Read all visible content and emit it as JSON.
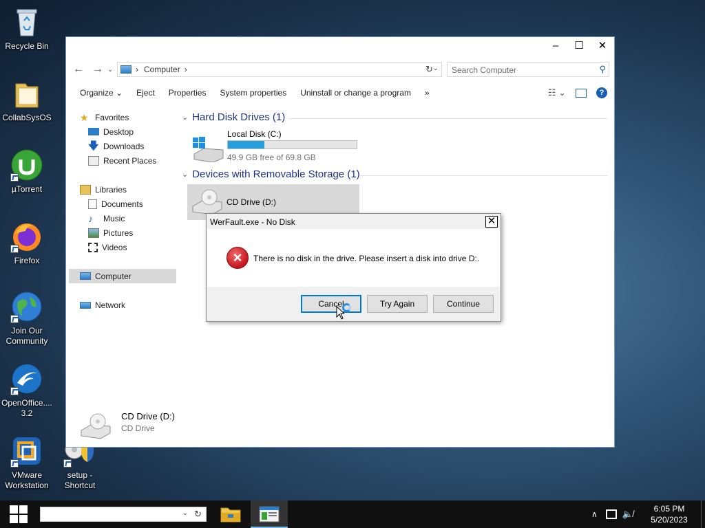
{
  "desktop": {
    "icons": [
      {
        "label": "Recycle Bin",
        "icon": "recycle-bin-icon"
      },
      {
        "label": "CollabSysOS",
        "icon": "folder-icon"
      },
      {
        "label": "µTorrent",
        "icon": "utorrent-icon"
      },
      {
        "label": "Firefox",
        "icon": "firefox-icon"
      },
      {
        "label": "Join Our Community",
        "icon": "globe-icon"
      },
      {
        "label": "OpenOffice.... 3.2",
        "icon": "openoffice-icon"
      },
      {
        "label": "VMware Workstation",
        "icon": "vmware-icon"
      },
      {
        "label": "setup - Shortcut",
        "icon": "setup-icon"
      }
    ]
  },
  "explorer": {
    "address": {
      "crumb": "Computer",
      "separator": "›"
    },
    "search_placeholder": "Search Computer",
    "toolbar": {
      "organize": "Organize ⌄",
      "eject": "Eject",
      "properties": "Properties",
      "system_properties": "System properties",
      "uninstall": "Uninstall or change a program",
      "more": "»"
    },
    "nav": {
      "favorites": "Favorites",
      "desktop": "Desktop",
      "downloads": "Downloads",
      "recent_places": "Recent Places",
      "libraries": "Libraries",
      "documents": "Documents",
      "music": "Music",
      "pictures": "Pictures",
      "videos": "Videos",
      "computer": "Computer",
      "network": "Network"
    },
    "groups": {
      "hard_disks": "Hard Disk Drives (1)",
      "removable": "Devices with Removable Storage (1)"
    },
    "local_disk": {
      "name": "Local Disk (C:)",
      "free": "49.9 GB free of 69.8 GB",
      "used_fraction": 0.285
    },
    "cd_drive": {
      "name": "CD Drive (D:)"
    },
    "details": {
      "name": "CD Drive (D:)",
      "type": "CD Drive"
    }
  },
  "dialog": {
    "title": "WerFault.exe - No Disk",
    "close": "✕",
    "message": "There is no disk in the drive. Please insert a disk into drive D:.",
    "buttons": {
      "cancel": "Cancel",
      "try_again": "Try Again",
      "continue": "Continue"
    }
  },
  "taskbar": {
    "time": "6:05 PM",
    "date": "5/20/2023"
  },
  "colors": {
    "accent": "#0078d7",
    "progress": "#26a0da",
    "error": "#c4161c"
  }
}
